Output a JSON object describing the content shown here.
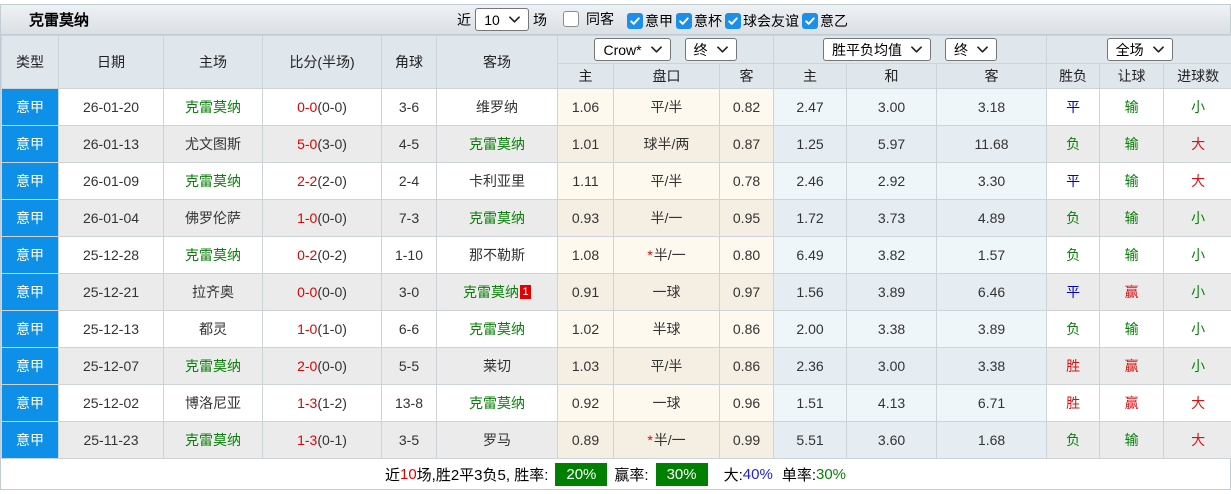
{
  "title": "克雷莫纳",
  "filters": {
    "recent_label": "近",
    "recent_value": "10",
    "recent_suffix": "场",
    "checkboxes": [
      {
        "label": "同客",
        "checked": false
      },
      {
        "label": "意甲",
        "checked": true
      },
      {
        "label": "意杯",
        "checked": true
      },
      {
        "label": "球会友谊",
        "checked": true
      },
      {
        "label": "意乙",
        "checked": true
      }
    ]
  },
  "table": {
    "main_headers": [
      "类型",
      "日期",
      "主场",
      "比分(半场)",
      "角球",
      "客场"
    ],
    "asian_group": {
      "book_select": "Crow*",
      "time_select": "终",
      "subheaders": [
        "主",
        "盘口",
        "客"
      ]
    },
    "europe_group": {
      "mean_select": "胜平负均值",
      "time_select": "终",
      "subheaders": [
        "主",
        "和",
        "客"
      ]
    },
    "fulltime_group": {
      "scope_select": "全场",
      "subheaders": [
        "胜负",
        "让球",
        "进球数"
      ]
    },
    "rows": [
      {
        "league": "意甲",
        "date": "26-01-20",
        "home": {
          "name": "克雷莫纳",
          "highlight": true
        },
        "score": "0-0",
        "half": "(0-0)",
        "corners": "3-6",
        "away": {
          "name": "维罗纳",
          "highlight": false
        },
        "asian": {
          "home": "1.06",
          "handicap": "平/半",
          "star": false,
          "away": "0.82"
        },
        "europe": {
          "home": "2.47",
          "draw": "3.00",
          "away": "3.18"
        },
        "outcome": {
          "text": "平",
          "color": "blue"
        },
        "handicap_result": {
          "text": "输",
          "color": "green"
        },
        "goals": {
          "text": "小",
          "color": "green"
        }
      },
      {
        "league": "意甲",
        "date": "26-01-13",
        "home": {
          "name": "尤文图斯",
          "highlight": false
        },
        "score": "5-0",
        "half": "(3-0)",
        "corners": "4-5",
        "away": {
          "name": "克雷莫纳",
          "highlight": true
        },
        "asian": {
          "home": "1.01",
          "handicap": "球半/两",
          "star": false,
          "away": "0.87"
        },
        "europe": {
          "home": "1.25",
          "draw": "5.97",
          "away": "11.68"
        },
        "outcome": {
          "text": "负",
          "color": "green"
        },
        "handicap_result": {
          "text": "输",
          "color": "green"
        },
        "goals": {
          "text": "大",
          "color": "red"
        }
      },
      {
        "league": "意甲",
        "date": "26-01-09",
        "home": {
          "name": "克雷莫纳",
          "highlight": true
        },
        "score": "2-2",
        "half": "(2-0)",
        "corners": "2-4",
        "away": {
          "name": "卡利亚里",
          "highlight": false
        },
        "asian": {
          "home": "1.11",
          "handicap": "平/半",
          "star": false,
          "away": "0.78"
        },
        "europe": {
          "home": "2.46",
          "draw": "2.92",
          "away": "3.30"
        },
        "outcome": {
          "text": "平",
          "color": "blue"
        },
        "handicap_result": {
          "text": "输",
          "color": "green"
        },
        "goals": {
          "text": "大",
          "color": "red"
        }
      },
      {
        "league": "意甲",
        "date": "26-01-04",
        "home": {
          "name": "佛罗伦萨",
          "highlight": false
        },
        "score": "1-0",
        "half": "(0-0)",
        "corners": "7-3",
        "away": {
          "name": "克雷莫纳",
          "highlight": true
        },
        "asian": {
          "home": "0.93",
          "handicap": "半/一",
          "star": false,
          "away": "0.95"
        },
        "europe": {
          "home": "1.72",
          "draw": "3.73",
          "away": "4.89"
        },
        "outcome": {
          "text": "负",
          "color": "green"
        },
        "handicap_result": {
          "text": "输",
          "color": "green"
        },
        "goals": {
          "text": "小",
          "color": "green"
        }
      },
      {
        "league": "意甲",
        "date": "25-12-28",
        "home": {
          "name": "克雷莫纳",
          "highlight": true
        },
        "score": "0-2",
        "half": "(0-2)",
        "corners": "1-10",
        "away": {
          "name": "那不勒斯",
          "highlight": false
        },
        "asian": {
          "home": "1.08",
          "handicap": "半/一",
          "star": true,
          "away": "0.80"
        },
        "europe": {
          "home": "6.49",
          "draw": "3.82",
          "away": "1.57"
        },
        "outcome": {
          "text": "负",
          "color": "green"
        },
        "handicap_result": {
          "text": "输",
          "color": "green"
        },
        "goals": {
          "text": "小",
          "color": "green"
        }
      },
      {
        "league": "意甲",
        "date": "25-12-21",
        "home": {
          "name": "拉齐奥",
          "highlight": false
        },
        "score": "0-0",
        "half": "(0-0)",
        "corners": "3-0",
        "away": {
          "name": "克雷莫纳",
          "highlight": true,
          "badge": "1"
        },
        "asian": {
          "home": "0.91",
          "handicap": "一球",
          "star": false,
          "away": "0.97"
        },
        "europe": {
          "home": "1.56",
          "draw": "3.89",
          "away": "6.46"
        },
        "outcome": {
          "text": "平",
          "color": "blue"
        },
        "handicap_result": {
          "text": "赢",
          "color": "red"
        },
        "goals": {
          "text": "小",
          "color": "green"
        }
      },
      {
        "league": "意甲",
        "date": "25-12-13",
        "home": {
          "name": "都灵",
          "highlight": false
        },
        "score": "1-0",
        "half": "(1-0)",
        "corners": "6-6",
        "away": {
          "name": "克雷莫纳",
          "highlight": true
        },
        "asian": {
          "home": "1.02",
          "handicap": "半球",
          "star": false,
          "away": "0.86"
        },
        "europe": {
          "home": "2.00",
          "draw": "3.38",
          "away": "3.89"
        },
        "outcome": {
          "text": "负",
          "color": "green"
        },
        "handicap_result": {
          "text": "输",
          "color": "green"
        },
        "goals": {
          "text": "小",
          "color": "green"
        }
      },
      {
        "league": "意甲",
        "date": "25-12-07",
        "home": {
          "name": "克雷莫纳",
          "highlight": true
        },
        "score": "2-0",
        "half": "(0-0)",
        "corners": "5-5",
        "away": {
          "name": "莱切",
          "highlight": false
        },
        "asian": {
          "home": "1.03",
          "handicap": "平/半",
          "star": false,
          "away": "0.86"
        },
        "europe": {
          "home": "2.36",
          "draw": "3.00",
          "away": "3.38"
        },
        "outcome": {
          "text": "胜",
          "color": "red"
        },
        "handicap_result": {
          "text": "赢",
          "color": "red"
        },
        "goals": {
          "text": "小",
          "color": "green"
        }
      },
      {
        "league": "意甲",
        "date": "25-12-02",
        "home": {
          "name": "博洛尼亚",
          "highlight": false
        },
        "score": "1-3",
        "half": "(1-2)",
        "corners": "13-8",
        "away": {
          "name": "克雷莫纳",
          "highlight": true
        },
        "asian": {
          "home": "0.92",
          "handicap": "一球",
          "star": false,
          "away": "0.96"
        },
        "europe": {
          "home": "1.51",
          "draw": "4.13",
          "away": "6.71"
        },
        "outcome": {
          "text": "胜",
          "color": "red"
        },
        "handicap_result": {
          "text": "赢",
          "color": "red"
        },
        "goals": {
          "text": "大",
          "color": "red"
        }
      },
      {
        "league": "意甲",
        "date": "25-11-23",
        "home": {
          "name": "克雷莫纳",
          "highlight": true
        },
        "score": "1-3",
        "half": "(0-1)",
        "corners": "3-5",
        "away": {
          "name": "罗马",
          "highlight": false
        },
        "asian": {
          "home": "0.89",
          "handicap": "半/一",
          "star": true,
          "away": "0.99"
        },
        "europe": {
          "home": "5.51",
          "draw": "3.60",
          "away": "1.68"
        },
        "outcome": {
          "text": "负",
          "color": "green"
        },
        "handicap_result": {
          "text": "输",
          "color": "green"
        },
        "goals": {
          "text": "大",
          "color": "red"
        }
      }
    ]
  },
  "summary": {
    "prefix_label": "近",
    "count": "10",
    "stats_text": "场,胜2平3负5, 胜率:",
    "win_rate_badge": "20%",
    "mid_label": "赢率:",
    "profit_rate_badge": "30%",
    "big_label": "大:",
    "big_value": "40%",
    "single_label": "单率:",
    "single_value": "30%"
  },
  "colors": {
    "league_badge_bg": "#0f90e8",
    "team_highlight": "#088108",
    "score_red": "#e60000",
    "win_red": "#dd1111",
    "draw_blue": "#0202cf",
    "lose_green": "#088108",
    "summary_badge_bg": "#008000",
    "checkbox_checked": "#1e8fe8"
  }
}
